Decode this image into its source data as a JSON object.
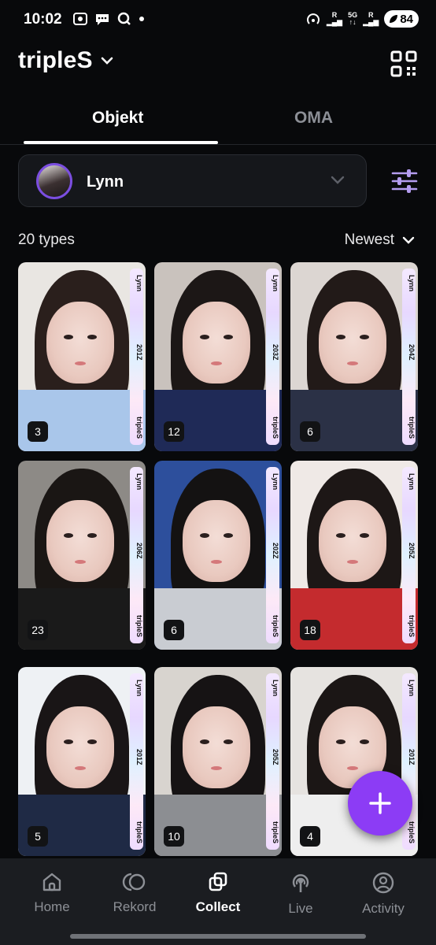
{
  "status_bar": {
    "time": "10:02",
    "battery": "84",
    "network": "5G",
    "signal_label": "R"
  },
  "header": {
    "brand": "tripleS"
  },
  "tabs": [
    {
      "label": "Objekt",
      "active": true
    },
    {
      "label": "OMA",
      "active": false
    }
  ],
  "member_selector": {
    "selected": "Lynn"
  },
  "list": {
    "count_label": "20 types",
    "sort_label": "Newest"
  },
  "objekts": [
    {
      "member": "Lynn",
      "number": "201Z",
      "group": "tripleS",
      "copies": "3",
      "hair": "#2a1f1c",
      "cloth": "#a9c6ea",
      "bg": "#e9e6e2"
    },
    {
      "member": "Lynn",
      "number": "203Z",
      "group": "tripleS",
      "copies": "12",
      "hair": "#1c1716",
      "cloth": "#1f2a57",
      "bg": "#c9c2bd"
    },
    {
      "member": "Lynn",
      "number": "204Z",
      "group": "tripleS",
      "copies": "6",
      "hair": "#221a18",
      "cloth": "#2b3146",
      "bg": "#dcd6d2"
    },
    {
      "member": "Lynn",
      "number": "206Z",
      "group": "tripleS",
      "copies": "23",
      "hair": "#1a1614",
      "cloth": "#1a1a1a",
      "bg": "#8d8a86"
    },
    {
      "member": "Lynn",
      "number": "202Z",
      "group": "tripleS",
      "copies": "6",
      "hair": "#141212",
      "cloth": "#c9ccd2",
      "bg": "#2d4f9c"
    },
    {
      "member": "Lynn",
      "number": "205Z",
      "group": "tripleS",
      "copies": "18",
      "hair": "#1d1716",
      "cloth": "#c42b2e",
      "bg": "#efe9e6"
    },
    {
      "member": "Lynn",
      "number": "201Z",
      "group": "tripleS",
      "copies": "5",
      "hair": "#191516",
      "cloth": "#1f2a45",
      "bg": "#eef1f4"
    },
    {
      "member": "Lynn",
      "number": "205Z",
      "group": "tripleS",
      "copies": "10",
      "hair": "#161314",
      "cloth": "#8c8e92",
      "bg": "#d8d4cf"
    },
    {
      "member": "Lynn",
      "number": "201Z",
      "group": "tripleS",
      "copies": "4",
      "hair": "#1b1615",
      "cloth": "#eeeeee",
      "bg": "#e6e3e0"
    }
  ],
  "nav": [
    {
      "label": "Home",
      "icon": "home-icon"
    },
    {
      "label": "Rekord",
      "icon": "rekord-icon"
    },
    {
      "label": "Collect",
      "icon": "collect-icon",
      "active": true
    },
    {
      "label": "Live",
      "icon": "live-icon"
    },
    {
      "label": "Activity",
      "icon": "activity-icon"
    }
  ],
  "colors": {
    "accent": "#8c3cf5",
    "avatar_ring": "#7b4ee0",
    "filter_icon": "#b49cf0"
  }
}
